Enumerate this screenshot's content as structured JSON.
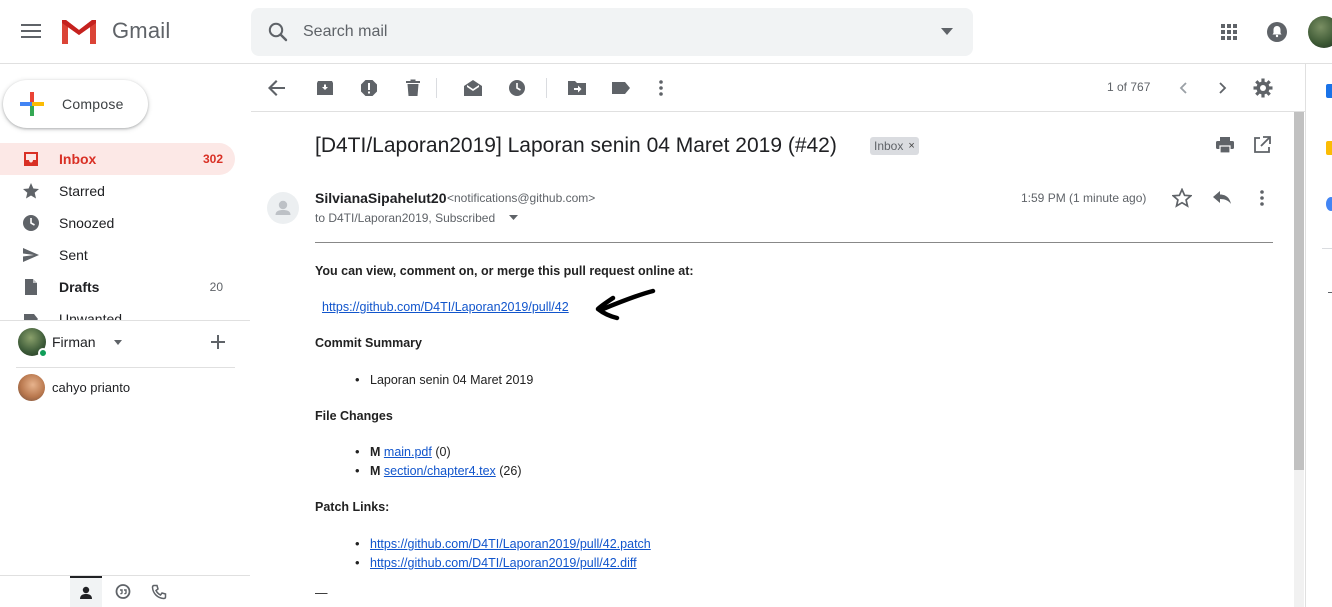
{
  "app": {
    "name": "Gmail"
  },
  "search": {
    "placeholder": "Search mail"
  },
  "compose": {
    "label": "Compose"
  },
  "nav": {
    "items": [
      {
        "label": "Inbox",
        "count": "302"
      },
      {
        "label": "Starred",
        "count": ""
      },
      {
        "label": "Snoozed",
        "count": ""
      },
      {
        "label": "Sent",
        "count": ""
      },
      {
        "label": "Drafts",
        "count": "20"
      },
      {
        "label": "Unwanted",
        "count": ""
      }
    ]
  },
  "hangouts": {
    "user": "Firman",
    "contacts": [
      {
        "name": "cahyo prianto"
      }
    ]
  },
  "toolbar": {
    "pager": "1 of 767"
  },
  "email": {
    "subject": "[D4TI/Laporan2019] Laporan senin 04 Maret 2019 (#42)",
    "label_tag": "Inbox",
    "label_remove": "×",
    "sender_name": "SilvianaSipahelut20",
    "sender_email": "<notifications@github.com>",
    "recipients": "to D4TI/Laporan2019, Subscribed",
    "time": "1:59 PM (1 minute ago)",
    "intro": "You can view, comment on, or merge this pull request online at:",
    "pr_link": "https://github.com/D4TI/Laporan2019/pull/42",
    "commit_heading": "Commit Summary",
    "commits": [
      "Laporan senin 04 Maret 2019"
    ],
    "file_heading": "File Changes",
    "files": [
      {
        "mode": "M",
        "name": "main.pdf",
        "changes": "(0)"
      },
      {
        "mode": "M",
        "name": "section/chapter4.tex",
        "changes": "(26)"
      }
    ],
    "patch_heading": "Patch Links:",
    "patch_links": [
      "https://github.com/D4TI/Laporan2019/pull/42.patch",
      "https://github.com/D4TI/Laporan2019/pull/42.diff"
    ],
    "signature_dash": "—"
  },
  "colors": {
    "accent_red": "#d93025",
    "active_bg": "#fce8e6",
    "link": "#1155cc",
    "online": "#0f9d58"
  }
}
